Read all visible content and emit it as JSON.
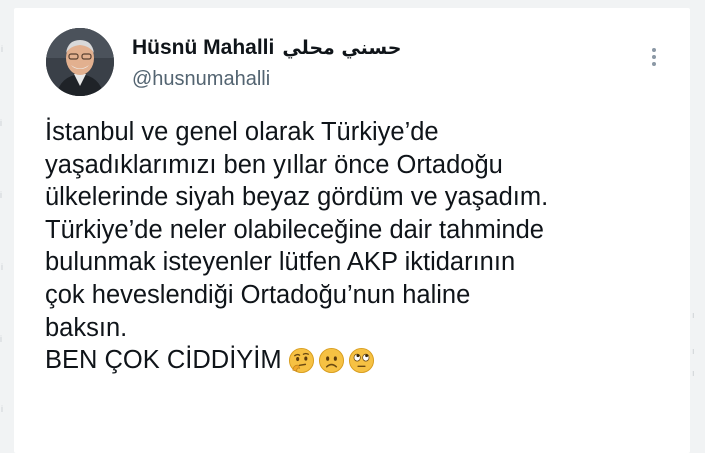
{
  "tweet": {
    "author": {
      "display_name": "Hüsnü Mahalli",
      "arabic_name": "حسني محلي",
      "handle": "@husnumahalli"
    },
    "more_icon": "more-vertical-icon",
    "lines": [
      "İstanbul ve genel olarak Türkiye’de",
      "yaşadıklarımızı ben yıllar önce Ortadoğu",
      "ülkelerinde siyah beyaz gördüm ve yaşadım.",
      "Türkiye’de neler olabileceğine dair tahminde",
      "bulunmak isteyenler lütfen AKP iktidarının",
      "çok heveslendiği Ortadoğu’nun haline",
      "baksın.",
      "BEN ÇOK CİDDİYİM"
    ],
    "emojis": [
      "thinking-face",
      "frowning-face",
      "face-with-rolling-eyes"
    ]
  },
  "colors": {
    "text": "#0f1419",
    "secondary": "#536471",
    "card_background": "#ffffff",
    "page_background": "#f1f3f4",
    "emoji_yellow": "#f6c143"
  }
}
